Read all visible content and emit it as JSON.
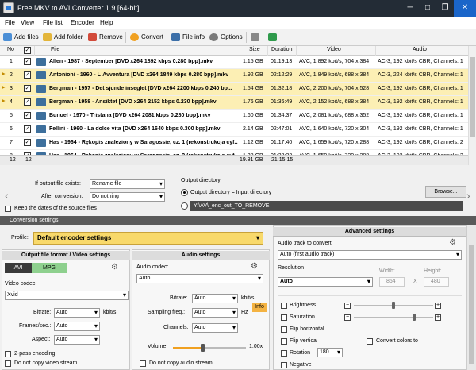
{
  "window": {
    "title": "Free MKV to AVI Converter 1.9  [64-bit]"
  },
  "menu": [
    "File",
    "View",
    "File list",
    "Encoder",
    "Help"
  ],
  "toolbar": {
    "add_files": "Add files",
    "add_folder": "Add folder",
    "remove": "Remove",
    "convert": "Convert",
    "file_info": "File info",
    "options": "Options"
  },
  "columns": {
    "no": "No",
    "file": "File",
    "size": "Size",
    "duration": "Duration",
    "video": "Video",
    "audio": "Audio"
  },
  "rows": [
    {
      "no": "1",
      "file": "Allen - 1987 - September [DVD x264 1892 kbps 0.280 bpp].mkv",
      "size": "1.15 GB",
      "duration": "01:19:13",
      "video": "AVC, 1 892 kbit/s, 704 x 384",
      "audio": "AC-3, 192 kbit/s CBR, Channels: 1",
      "sel": false
    },
    {
      "no": "2",
      "file": "Antonioni - 1960 - L`Avventura [DVD x264 1849 kbps 0.280 bpp].mkv",
      "size": "1.92 GB",
      "duration": "02:12:29",
      "video": "AVC, 1 849 kbit/s, 688 x 384",
      "audio": "AC-3, 224 kbit/s CBR, Channels: 1",
      "sel": true
    },
    {
      "no": "3",
      "file": "Bergman - 1957 - Det sjunde inseglet [DVD x264 2200 kbps 0.240 bp...",
      "size": "1.54 GB",
      "duration": "01:32:18",
      "video": "AVC, 2 200 kbit/s, 704 x 528",
      "audio": "AC-3, 192 kbit/s CBR, Channels: 1",
      "sel": true
    },
    {
      "no": "4",
      "file": "Bergman - 1958 - Ansiktet [DVD x264 2152 kbps 0.230 bpp].mkv",
      "size": "1.76 GB",
      "duration": "01:36:49",
      "video": "AVC, 2 152 kbit/s, 688 x 384",
      "audio": "AC-3, 192 kbit/s CBR, Channels: 1",
      "sel": true
    },
    {
      "no": "5",
      "file": "Bunuel - 1970 - Tristana [DVD x264 2081 kbps 0.280 bpp].mkv",
      "size": "1.60 GB",
      "duration": "01:34:37",
      "video": "AVC, 2 081 kbit/s, 688 x 352",
      "audio": "AC-3, 192 kbit/s CBR, Channels: 1",
      "sel": false
    },
    {
      "no": "6",
      "file": "Fellini - 1960 - La dolce vita [DVD x264 1640 kbps 0.300 bpp].mkv",
      "size": "2.14 GB",
      "duration": "02:47:01",
      "video": "AVC, 1 640 kbit/s, 720 x 304",
      "audio": "AC-3, 192 kbit/s CBR, Channels: 1",
      "sel": false
    },
    {
      "no": "7",
      "file": "Has - 1964 - Rękopis znaleziony w Saragossie, cz. 1 (rekonstrukcja cyf...",
      "size": "1.12 GB",
      "duration": "01:17:40",
      "video": "AVC, 1 659 kbit/s, 720 x 288",
      "audio": "AC-3, 192 kbit/s CBR, Channels: 2",
      "sel": false
    },
    {
      "no": "8",
      "file": "Has - 1964 - Rękopis znaleziony w Saragossie, cz. 2 (rekonstrukcja cyf...",
      "size": "1.38 GB",
      "duration": "01:38:33",
      "video": "AVC, 1 659 kbit/s, 720 x 288",
      "audio": "AC-3, 192 kbit/s CBR, Channels: 2",
      "sel": false
    }
  ],
  "footer": {
    "count1": "12",
    "count2": "12",
    "total_size": "19.81 GB",
    "total_duration": "21:15:15"
  },
  "options": {
    "if_exists_label": "If output file exists:",
    "if_exists_value": "Rename file",
    "after_conv_label": "After conversion:",
    "after_conv_value": "Do nothing",
    "keep_dates": "Keep the dates of the source files",
    "output_dir_label": "Output directory",
    "radio_same": "Output directory = Input directory",
    "path": "Y:\\AV\\_enc_out_TO_REMOVE",
    "browse": "Browse..."
  },
  "conversion": {
    "header": "Conversion settings",
    "profile_label": "Profile:",
    "profile_value": "Default encoder settings",
    "video_panel": "Output file format / Video settings",
    "tab_avi": "AVI",
    "tab_mpg": "MPG",
    "video_codec_label": "Video codec:",
    "video_codec": "Xvid",
    "bitrate_label": "Bitrate:",
    "bitrate": "Auto",
    "kbits": "kbit/s",
    "fps_label": "Frames/sec.:",
    "fps": "Auto",
    "aspect_label": "Aspect:",
    "aspect": "Auto",
    "twopass": "2-pass encoding",
    "no_video": "Do not copy video stream",
    "audio_panel": "Audio settings",
    "audio_codec_label": "Audio codec:",
    "audio_codec": "Auto",
    "a_bitrate_label": "Bitrate:",
    "a_bitrate": "Auto",
    "a_kbits": "kbit/s",
    "freq_label": "Sampling freq.:",
    "freq": "Auto",
    "hz": "Hz",
    "info": "Info",
    "channels_label": "Channels:",
    "channels": "Auto",
    "volume_label": "Volume:",
    "volume_value": "1.00x",
    "volume_level": 0.4,
    "no_audio": "Do not copy audio stream",
    "advanced": "Advanced settings",
    "audio_track_label": "Audio track to convert",
    "audio_track": "Auto (first audio track)",
    "resolution_label": "Resolution",
    "resolution": "Auto",
    "width_label": "Width:",
    "width": "854",
    "height_label": "Height:",
    "height": "480",
    "x": "X",
    "brightness": "Brightness",
    "saturation": "Saturation",
    "flip_h": "Flip horizontal",
    "flip_v": "Flip vertical",
    "rotation": "Rotation",
    "rotation_value": "180",
    "negative": "Negative",
    "convert_colors": "Convert colors to"
  }
}
